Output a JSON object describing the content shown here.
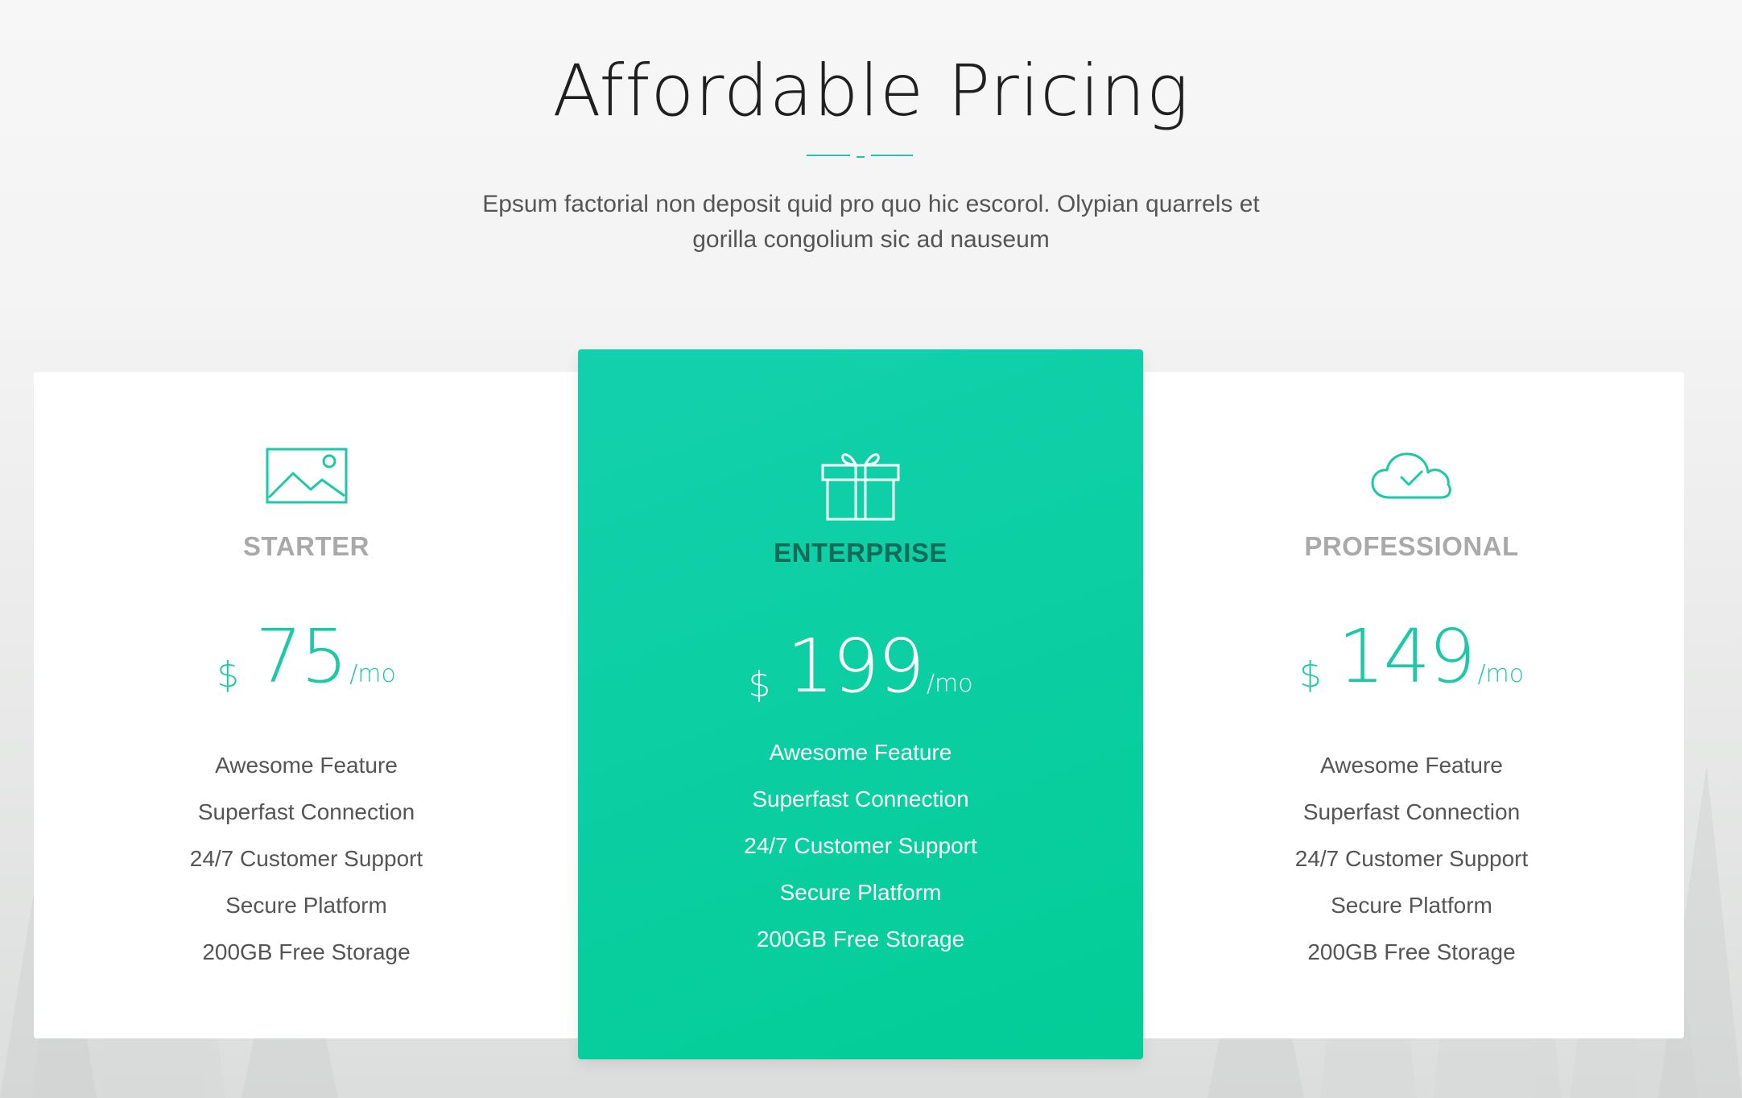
{
  "header": {
    "title": "Affordable Pricing",
    "subtitle": "Epsum factorial non deposit quid pro quo hic escorol. Olypian quarrels et gorilla congolium sic ad nauseum"
  },
  "colors": {
    "accent": "#1ac9a8",
    "featured_bg": "#05cd9a",
    "featured_label": "#116b5a",
    "plan_name_muted": "#a9a9a9",
    "feature_text": "#555555"
  },
  "plans": [
    {
      "name": "STARTER",
      "icon": "image-icon",
      "currency": "$",
      "amount": "75",
      "period": "/mo",
      "features": [
        "Awesome Feature",
        "Superfast Connection",
        "24/7 Customer Support",
        "Secure Platform",
        "200GB Free Storage"
      ]
    },
    {
      "name": "ENTERPRISE",
      "icon": "gift-icon",
      "currency": "$",
      "amount": "199",
      "period": "/mo",
      "featured": true,
      "features": [
        "Awesome Feature",
        "Superfast Connection",
        "24/7 Customer Support",
        "Secure Platform",
        "200GB Free Storage"
      ]
    },
    {
      "name": "PROFESSIONAL",
      "icon": "cloud-check-icon",
      "currency": "$",
      "amount": "149",
      "period": "/mo",
      "features": [
        "Awesome Feature",
        "Superfast Connection",
        "24/7 Customer Support",
        "Secure Platform",
        "200GB Free Storage"
      ]
    }
  ]
}
